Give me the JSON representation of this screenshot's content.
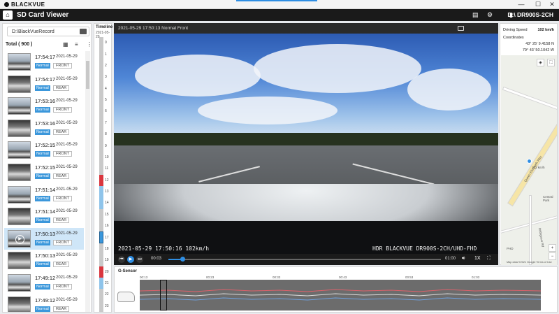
{
  "app": {
    "logo_text": "BLACKVUE",
    "window_controls": {
      "minimize": "—",
      "maximize": "☐",
      "close": "✕"
    },
    "title": "SD Card Viewer",
    "device": "D:\\ DR900S-2CH"
  },
  "sidebar": {
    "path": "D:\\BlackVueRecord",
    "total_label": "Total ( 900 )",
    "files": [
      {
        "time": "17:54:17",
        "date": "2021-05-29",
        "type": "Normal",
        "camera": "FRONT",
        "selected": false
      },
      {
        "time": "17:54:17",
        "date": "2021-05-29",
        "type": "Normal",
        "camera": "REAR",
        "selected": false
      },
      {
        "time": "17:53:16",
        "date": "2021-05-29",
        "type": "Normal",
        "camera": "FRONT",
        "selected": false
      },
      {
        "time": "17:53:16",
        "date": "2021-05-29",
        "type": "Normal",
        "camera": "REAR",
        "selected": false
      },
      {
        "time": "17:52:15",
        "date": "2021-05-29",
        "type": "Normal",
        "camera": "FRONT",
        "selected": false
      },
      {
        "time": "17:52:15",
        "date": "2021-05-29",
        "type": "Normal",
        "camera": "REAR",
        "selected": false
      },
      {
        "time": "17:51:14",
        "date": "2021-05-29",
        "type": "Normal",
        "camera": "FRONT",
        "selected": false
      },
      {
        "time": "17:51:14",
        "date": "2021-05-29",
        "type": "Normal",
        "camera": "REAR",
        "selected": false
      },
      {
        "time": "17:50:13",
        "date": "2021-05-29",
        "type": "Normal",
        "camera": "FRONT",
        "selected": true
      },
      {
        "time": "17:50:13",
        "date": "2021-05-29",
        "type": "Normal",
        "camera": "REAR",
        "selected": false
      },
      {
        "time": "17:49:12",
        "date": "2021-05-29",
        "type": "Normal",
        "camera": "FRONT",
        "selected": false
      },
      {
        "time": "17:49:12",
        "date": "2021-05-29",
        "type": "Normal",
        "camera": "REAR",
        "selected": false
      }
    ]
  },
  "timeline": {
    "title": "Timeline",
    "date": "2021-05-29",
    "hours": [
      "0",
      "1",
      "2",
      "3",
      "4",
      "5",
      "6",
      "7",
      "8",
      "9",
      "10",
      "11",
      "12",
      "13",
      "14",
      "15",
      "16",
      "17",
      "18",
      "19",
      "20",
      "21",
      "22",
      "23"
    ],
    "colors": {
      "normal": "#c9c9c9",
      "event": "#d9363e",
      "selected": "#3b97db"
    }
  },
  "video": {
    "title": "2021-05-29 17:50:13 Normal Front",
    "overlay_left": "2021-05-29 17:50:16 102km/h",
    "overlay_right": "HDR  BLACKVUE DR900S-2CH/UHD-FHD",
    "current_time": "00:03",
    "duration": "01:00",
    "speed": "1X",
    "progress": 0.05
  },
  "info": {
    "speed_label": "Driving Speed",
    "speed_value": "102 km/h",
    "coords_label": "Coordinates",
    "lat": "43° 25' 9.4158 N",
    "lon": "79° 43' 50.1042 W"
  },
  "map": {
    "label_road": "Queen Elizabeth Way",
    "pin_speed": "102 km/h",
    "label_park": "Central Park",
    "label_ph": "PHD",
    "label_road2": "Ditthgrove Rd",
    "copyright": "Map data ©2021 Google  Terms of Use",
    "zoom_in": "+",
    "zoom_out": "−"
  },
  "gsensor": {
    "title": "G-Sensor",
    "ticks": [
      "00:13",
      "00:23",
      "00:33",
      "00:43",
      "00:53",
      "01:03"
    ]
  }
}
